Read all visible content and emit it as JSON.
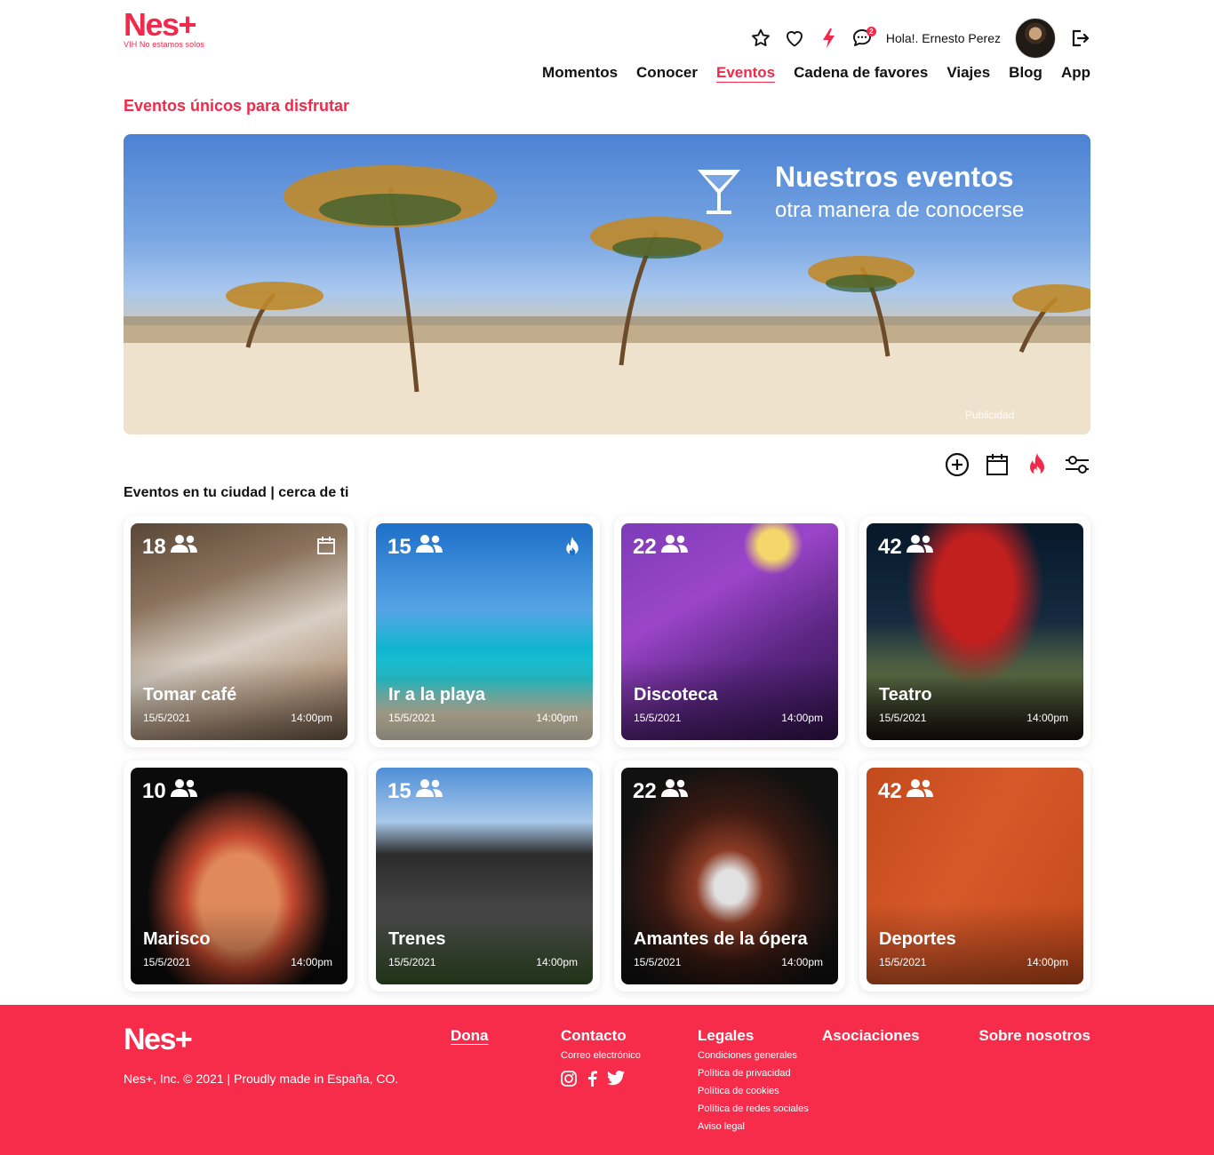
{
  "app": {
    "brand": "Nes+",
    "tagline": "VIH No estamos solos"
  },
  "header": {
    "greeting": "Hola!. Ernesto Perez",
    "messages_badge": "2",
    "icons": [
      "star-icon",
      "heart-icon",
      "flash-icon",
      "chat-icon",
      "logout-icon"
    ]
  },
  "nav": {
    "items": [
      "Momentos",
      "Conocer",
      "Eventos",
      "Cadena de favores",
      "Viajes",
      "Blog",
      "App"
    ],
    "active": "Eventos"
  },
  "page": {
    "section_title": "Eventos únicos para disfrutar",
    "city_label": "Eventos en tu ciudad | cerca de ti"
  },
  "banner": {
    "title": "Nuestros eventos",
    "subtitle": "otra manera de conocerse",
    "ad_label": "Publicidad"
  },
  "tools": [
    "add-circle-icon",
    "calendar-icon",
    "fire-icon",
    "filter-sliders-icon"
  ],
  "events": [
    {
      "count": "18",
      "title": "Tomar café",
      "date": "15/5/2021",
      "time": "14:00pm",
      "badge": "calendar"
    },
    {
      "count": "15",
      "title": "Ir a la playa",
      "date": "15/5/2021",
      "time": "14:00pm",
      "badge": "fire"
    },
    {
      "count": "22",
      "title": "Discoteca",
      "date": "15/5/2021",
      "time": "14:00pm"
    },
    {
      "count": "42",
      "title": "Teatro",
      "date": "15/5/2021",
      "time": "14:00pm"
    },
    {
      "count": "10",
      "title": "Marisco",
      "date": "15/5/2021",
      "time": "14:00pm"
    },
    {
      "count": "15",
      "title": "Trenes",
      "date": "15/5/2021",
      "time": "14:00pm"
    },
    {
      "count": "22",
      "title": "Amantes de la ópera",
      "date": "15/5/2021",
      "time": "14:00pm"
    },
    {
      "count": "42",
      "title": "Deportes",
      "date": "15/5/2021",
      "time": "14:00pm"
    }
  ],
  "footer": {
    "brand": "Nes+",
    "copyright": "Nes+, Inc. © 2021 | Proudly made in España, CO.",
    "dona": "Dona",
    "contacto": {
      "title": "Contacto",
      "email": "Correo electrónico"
    },
    "legales": {
      "title": "Legales",
      "links": [
        "Condiciones generales",
        "Política de privacidad",
        "Política de cookies",
        "Política de redes sociales",
        "Aviso legal"
      ]
    },
    "asociaciones": "Asociaciones",
    "sobre": "Sobre nosotros",
    "social": [
      "instagram-icon",
      "facebook-icon",
      "twitter-icon"
    ]
  },
  "colors": {
    "accent": "#f2294a",
    "footer_bg": "#f72c4b"
  }
}
